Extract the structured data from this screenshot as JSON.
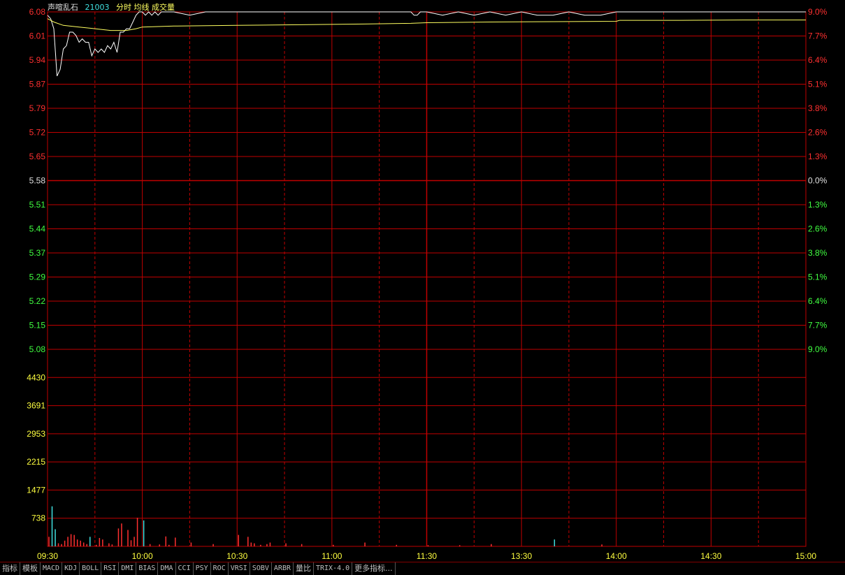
{
  "header": {
    "stock_name": "声喧乱石",
    "stock_code": "21003",
    "indicators": "分时 均线 成交量"
  },
  "colors": {
    "background": "#000000",
    "grid": "#c00000",
    "price_line": "#ffffff",
    "avg_line": "#ffff60",
    "up": "#ff3030",
    "down": "#40ff40",
    "neutral": "#e0e0e0",
    "volume_axis": "#ffff40",
    "vol_up": "#ff3030",
    "vol_down": "#40e0e0"
  },
  "toolbar": {
    "tabs": [
      "指标",
      "模板",
      "MACD",
      "KDJ",
      "BOLL",
      "RSI",
      "DMI",
      "BIAS",
      "DMA",
      "CCI",
      "PSY",
      "ROC",
      "VRSI",
      "SOBV",
      "ARBR",
      "量比",
      "TRIX-4.0",
      "更多指标..."
    ]
  },
  "chart_data": [
    {
      "type": "line",
      "title": "分时",
      "prev_close": 5.58,
      "ylim": [
        5.08,
        6.08
      ],
      "y_ticks_left": [
        "6.08",
        "6.01",
        "5.94",
        "5.87",
        "5.79",
        "5.72",
        "5.65",
        "5.58",
        "5.51",
        "5.44",
        "5.37",
        "5.29",
        "5.22",
        "5.15",
        "5.08"
      ],
      "y_ticks_right": [
        "9.0%",
        "7.7%",
        "6.4%",
        "5.1%",
        "3.8%",
        "2.6%",
        "1.3%",
        "0.0%",
        "1.3%",
        "2.6%",
        "3.8%",
        "5.1%",
        "6.4%",
        "7.7%",
        "9.0%"
      ],
      "x_ticks": [
        "09:30",
        "10:00",
        "10:30",
        "11:00",
        "11:30",
        "13:30",
        "14:00",
        "14:30",
        "15:00"
      ],
      "series": [
        {
          "name": "分时",
          "x": [
            0,
            1,
            2,
            3,
            4,
            5,
            6,
            7,
            8,
            9,
            10,
            11,
            12,
            13,
            14,
            15,
            16,
            17,
            18,
            19,
            20,
            21,
            22,
            23,
            24,
            25,
            26,
            27,
            28,
            29,
            30,
            31,
            32,
            33,
            34,
            35,
            36,
            37,
            38,
            39,
            40,
            45,
            50,
            55,
            60,
            70,
            80,
            90,
            100,
            115,
            116,
            117,
            118,
            119,
            120,
            125,
            130,
            135,
            140,
            145,
            150,
            155,
            160,
            165,
            170,
            175,
            180,
            181,
            182,
            190,
            200,
            210,
            220,
            230,
            240
          ],
          "values": [
            6.07,
            6.06,
            6.03,
            5.89,
            5.91,
            5.97,
            5.98,
            6.02,
            6.02,
            6.01,
            5.99,
            6.0,
            5.99,
            5.99,
            5.95,
            5.97,
            5.96,
            5.97,
            5.96,
            5.98,
            5.97,
            5.99,
            5.96,
            6.02,
            6.02,
            6.03,
            6.03,
            6.05,
            6.07,
            6.08,
            6.08,
            6.07,
            6.08,
            6.07,
            6.08,
            6.07,
            6.08,
            6.08,
            6.08,
            6.08,
            6.08,
            6.07,
            6.08,
            6.08,
            6.08,
            6.08,
            6.08,
            6.08,
            6.08,
            6.08,
            6.07,
            6.07,
            6.08,
            6.08,
            6.08,
            6.07,
            6.08,
            6.07,
            6.08,
            6.07,
            6.08,
            6.07,
            6.07,
            6.08,
            6.07,
            6.07,
            6.08,
            6.08,
            6.08,
            6.08,
            6.08,
            6.08,
            6.08,
            6.08,
            6.08
          ]
        },
        {
          "name": "均线",
          "x": [
            0,
            2,
            5,
            10,
            15,
            20,
            25,
            28,
            30,
            40,
            60,
            80,
            100,
            115,
            120,
            140,
            160,
            180,
            181,
            200,
            220,
            240
          ],
          "values": [
            6.06,
            6.05,
            6.04,
            6.035,
            6.03,
            6.025,
            6.025,
            6.03,
            6.035,
            6.038,
            6.04,
            6.042,
            6.044,
            6.046,
            6.048,
            6.05,
            6.051,
            6.052,
            6.055,
            6.055,
            6.056,
            6.056
          ]
        }
      ]
    },
    {
      "type": "bar",
      "title": "成交量",
      "ylim": [
        0,
        5168
      ],
      "y_ticks": [
        "4430",
        "3691",
        "2953",
        "2215",
        "1477",
        "738"
      ],
      "x": [
        0,
        1,
        2,
        3,
        4,
        5,
        6,
        7,
        8,
        9,
        10,
        11,
        12,
        13,
        15,
        16,
        17,
        19,
        20,
        22,
        23,
        25,
        26,
        27,
        28,
        30,
        32,
        35,
        37,
        38,
        40,
        45,
        52,
        60,
        63,
        64,
        65,
        67,
        69,
        70,
        75,
        80,
        90,
        100,
        110,
        120,
        130,
        140,
        160,
        175
      ],
      "values": [
        250,
        1050,
        450,
        80,
        60,
        150,
        250,
        320,
        300,
        180,
        150,
        100,
        60,
        250,
        40,
        220,
        180,
        80,
        50,
        470,
        600,
        430,
        160,
        250,
        750,
        680,
        60,
        50,
        260,
        40,
        230,
        100,
        60,
        300,
        250,
        100,
        80,
        40,
        60,
        100,
        80,
        60,
        40,
        100,
        40,
        30,
        30,
        60,
        180,
        50
      ],
      "colors": [
        "up",
        "down",
        "down",
        "up",
        "up",
        "up",
        "up",
        "up",
        "up",
        "up",
        "up",
        "up",
        "up",
        "down",
        "up",
        "up",
        "up",
        "up",
        "up",
        "up",
        "up",
        "up",
        "up",
        "up",
        "up",
        "down",
        "up",
        "up",
        "up",
        "up",
        "up",
        "up",
        "up",
        "up",
        "up",
        "up",
        "up",
        "up",
        "up",
        "up",
        "up",
        "up",
        "up",
        "up",
        "up",
        "up",
        "up",
        "up",
        "down",
        "up"
      ]
    }
  ]
}
